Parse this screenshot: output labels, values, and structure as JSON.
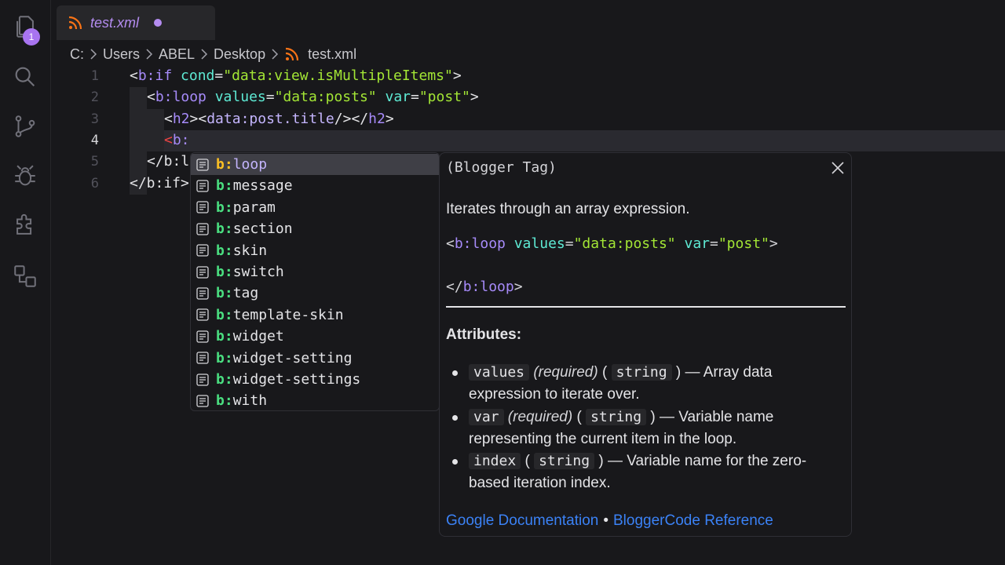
{
  "activity_bar": {
    "explorer_badge": "1",
    "icons": [
      "files-icon",
      "search-icon",
      "source-control-icon",
      "debug-icon",
      "extensions-icon",
      "remote-explorer-icon"
    ]
  },
  "tab": {
    "label": "test.xml",
    "modified": true,
    "accent": "#b48cf0"
  },
  "breadcrumb": [
    "C:",
    "Users",
    "ABEL",
    "Desktop",
    "test.xml"
  ],
  "editor": {
    "active_line": 4,
    "lines": [
      {
        "num": "1"
      },
      {
        "num": "2"
      },
      {
        "num": "3"
      },
      {
        "num": "4"
      },
      {
        "num": "5"
      },
      {
        "num": "6"
      }
    ],
    "code": {
      "l1": {
        "open": "<",
        "tag": "b:if",
        "attr": "cond",
        "eq": "=",
        "val": "\"data:view.isMultipleItems\"",
        "close": ">"
      },
      "l2": {
        "open": "<",
        "tag": "b:loop",
        "attr1": "values",
        "eq1": "=",
        "val1": "\"data:posts\"",
        "attr2": "var",
        "eq2": "=",
        "val2": "\"post\"",
        "close": ">"
      },
      "l3": {
        "a": "<",
        "h2open": "h2",
        "b": "><",
        "data": "data:post.title",
        "c": "/></",
        "h2close": "h2",
        "d": ">"
      },
      "l4": {
        "lt": "<",
        "typed": "b:"
      },
      "l5": {
        "text": "</b:l"
      },
      "l6": {
        "text": "</b:if>"
      }
    }
  },
  "suggest": {
    "prefix": "b:",
    "items": [
      "loop",
      "message",
      "param",
      "section",
      "skin",
      "switch",
      "tag",
      "template-skin",
      "widget",
      "widget-setting",
      "widget-settings",
      "with"
    ],
    "selected_index": 0
  },
  "details": {
    "kind": "(Blogger Tag)",
    "description": "Iterates through an array expression.",
    "example": {
      "open": "<",
      "tag": "b:loop",
      "attr1": "values",
      "eq": "=",
      "val1": "\"data:posts\"",
      "attr2": "var",
      "val2": "\"post\"",
      "close": ">",
      "end_open": "</",
      "end_tag": "b:loop",
      "end_close": ">"
    },
    "attributes_heading": "Attributes:",
    "attributes": [
      {
        "name": "values",
        "required": "(required)",
        "type": "string",
        "desc": "— Array data expression to iterate over."
      },
      {
        "name": "var",
        "required": "(required)",
        "type": "string",
        "desc": "— Variable name representing the current item in the loop."
      },
      {
        "name": "index",
        "required": "",
        "type": "string",
        "desc": "— Variable name for the zero-based iteration index."
      }
    ],
    "link_google": "Google Documentation",
    "link_separator": "•",
    "link_bloggercode": "BloggerCode Reference"
  }
}
